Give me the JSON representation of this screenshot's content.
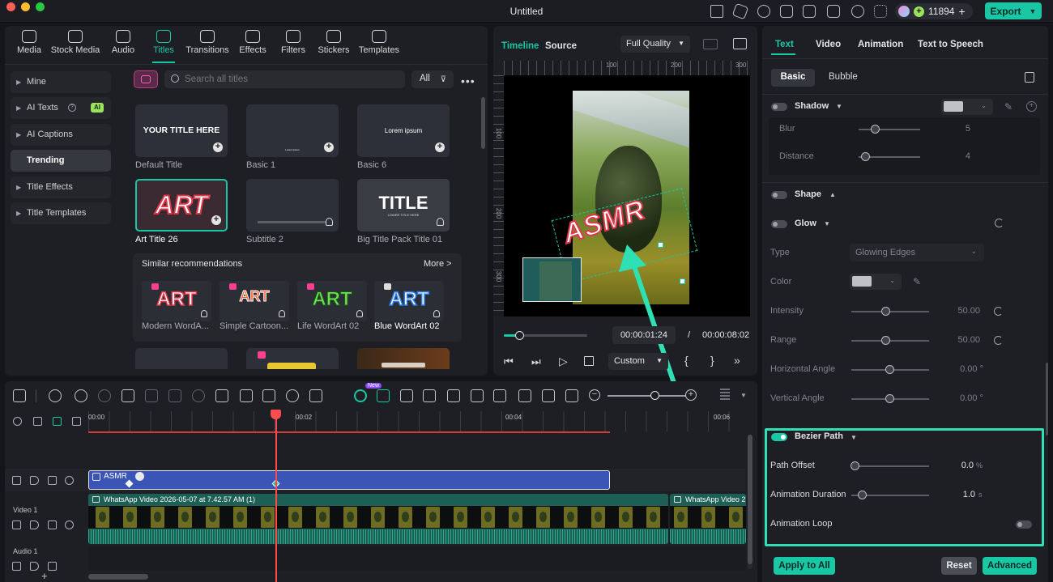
{
  "window": {
    "title": "Untitled"
  },
  "topbar": {
    "credits": "11894",
    "export_label": "Export"
  },
  "nav_tabs": [
    {
      "label": "Media",
      "icon": "media-icon"
    },
    {
      "label": "Stock Media",
      "icon": "stock-media-icon"
    },
    {
      "label": "Audio",
      "icon": "audio-icon"
    },
    {
      "label": "Titles",
      "icon": "titles-icon",
      "active": true
    },
    {
      "label": "Transitions",
      "icon": "transitions-icon"
    },
    {
      "label": "Effects",
      "icon": "effects-icon"
    },
    {
      "label": "Filters",
      "icon": "filters-icon"
    },
    {
      "label": "Stickers",
      "icon": "stickers-icon"
    },
    {
      "label": "Templates",
      "icon": "templates-icon"
    }
  ],
  "sidebar": {
    "items": [
      {
        "label": "Mine"
      },
      {
        "label": "AI Texts",
        "badge": "AI"
      },
      {
        "label": "AI Captions"
      },
      {
        "label": "Trending",
        "active": true
      },
      {
        "label": "Title Effects"
      },
      {
        "label": "Title Templates"
      }
    ]
  },
  "search": {
    "placeholder": "Search all titles",
    "filter_label": "All"
  },
  "titles": [
    {
      "name": "Default Title",
      "thumb_text": "YOUR TITLE HERE"
    },
    {
      "name": "Basic 1",
      "thumb_text": "Lorem ipsum"
    },
    {
      "name": "Basic 6",
      "thumb_text": "Lorem ipsum"
    },
    {
      "name": "Art Title 26",
      "thumb_text": "ART"
    },
    {
      "name": "Subtitle 2",
      "thumb_text": ""
    },
    {
      "name": "Big Title Pack Title 01",
      "thumb_text": "TITLE",
      "thumb_sub": "LOWER TITLE HERE"
    }
  ],
  "recommendations": {
    "heading": "Similar recommendations",
    "more_label": "More >",
    "items": [
      {
        "name": "Modern WordA...",
        "thumb_text": "ART"
      },
      {
        "name": "Simple Cartoon...",
        "thumb_text": "ART"
      },
      {
        "name": "Life WordArt 02",
        "thumb_text": "ART"
      },
      {
        "name": "Blue WordArt 02",
        "thumb_text": "ART"
      }
    ]
  },
  "preview": {
    "tabs": [
      "Timeline",
      "Source"
    ],
    "quality": "Full Quality",
    "ruler_marks": [
      "100",
      "200",
      "300"
    ],
    "vruler_marks": [
      "100",
      "200",
      "300"
    ],
    "overlay_text": "ASMR",
    "current_time": "00:00:01:24",
    "separator": "/",
    "total_time": "00:00:08:02",
    "zoom_label": "Custom",
    "progress": 0.18
  },
  "right_panel": {
    "tabs": [
      "Text",
      "Video",
      "Animation",
      "Text to Speech"
    ],
    "subtabs": [
      "Basic",
      "Bubble"
    ],
    "shadow": {
      "label": "Shadow",
      "blur_label": "Blur",
      "blur_value": "5",
      "distance_label": "Distance",
      "distance_value": "4"
    },
    "shape": {
      "label": "Shape"
    },
    "glow": {
      "label": "Glow",
      "type_label": "Type",
      "type_value": "Glowing Edges",
      "color_label": "Color",
      "intensity_label": "Intensity",
      "intensity_value": "50.00",
      "range_label": "Range",
      "range_value": "50.00",
      "hangle_label": "Horizontal Angle",
      "hangle_value": "0.00 °",
      "vangle_label": "Vertical Angle",
      "vangle_value": "0.00 °"
    },
    "bezier": {
      "label": "Bezier Path",
      "offset_label": "Path Offset",
      "offset_value": "0.0",
      "offset_unit": "%",
      "duration_label": "Animation Duration",
      "duration_value": "1.0",
      "duration_unit": "s",
      "loop_label": "Animation Loop"
    },
    "buttons": {
      "apply_all": "Apply to All",
      "reset": "Reset",
      "advanced": "Advanced"
    }
  },
  "timeline": {
    "times": [
      "00:00",
      "00:02",
      "00:04",
      "00:06"
    ],
    "title_clip": "ASMR",
    "video_clip": "WhatsApp Video 2026-05-07 at 7.42.57 AM (1)",
    "video_clip2": "WhatsApp Video 2",
    "video_track_label": "Video 1",
    "audio_track_label": "Audio 1",
    "new_badge": "New"
  },
  "colors": {
    "accent": "#19c7a4",
    "clip_blue": "#3a55b5",
    "playhead": "#ff4d4d"
  }
}
